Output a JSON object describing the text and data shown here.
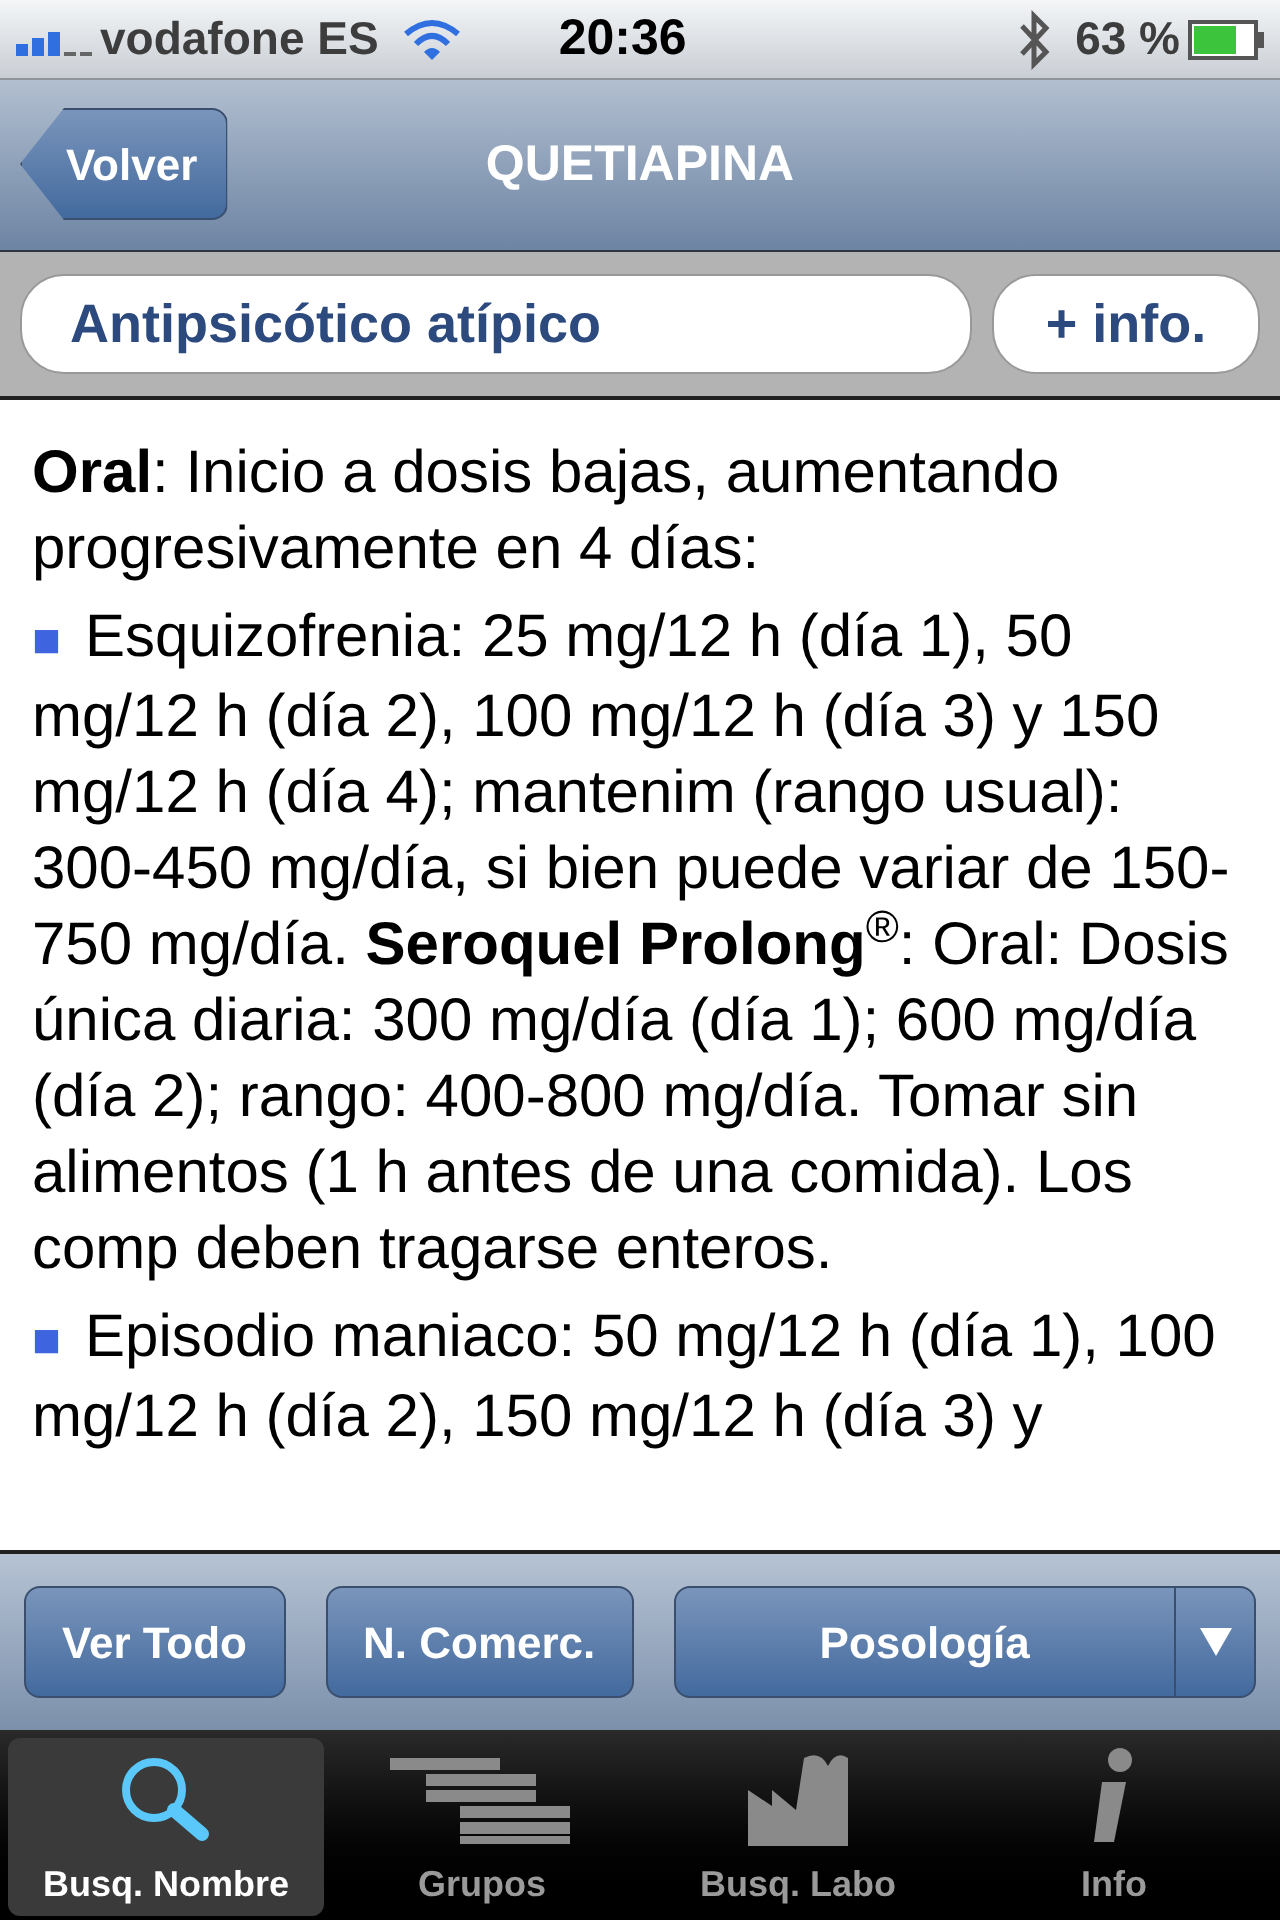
{
  "status_bar": {
    "carrier": "vodafone ES",
    "time": "20:36",
    "battery": "63 %"
  },
  "nav": {
    "back": "Volver",
    "title": "QUETIAPINA"
  },
  "header": {
    "group": "Antipsicótico atípico",
    "more": "+ info."
  },
  "content": [
    {
      "kind": "text",
      "text": "**Oral**: Inicio a dosis bajas, aumentando progresivamente en 4 días:"
    },
    {
      "kind": "bullet",
      "marker": "■",
      "text": "Esquizofrenia: 25 mg/12 h (día 1), 50 mg/12 h (día 2), 100 mg/12 h (día 3) y 150 mg/12 h (día 4); mantenim (rango usual): 300-450 mg/día, si bien puede variar de 150-750 mg/día. **Seroquel Prolong**$^{®}$: Oral: Dosis única diaria: 300 mg/día (día 1); 600 mg/día (día 2); rango: 400-800 mg/día. Tomar sin alimentos (1 h antes de una comida). Los comp deben tragarse enteros."
    },
    {
      "kind": "bullet",
      "marker": "■",
      "text": "Episodio maniaco: 50 mg/12 h (día 1), 100 mg/12 h (día 2), 150 mg/12 h (día 3) y"
    }
  ],
  "toolbar": {
    "buttons": [
      "Ver Todo",
      "N. Comerc."
    ],
    "dropdown": "Posología"
  },
  "tabs": [
    {
      "label": "Busq. Nombre",
      "selected": true,
      "kind": "search"
    },
    {
      "label": "Grupos",
      "selected": false,
      "kind": "groups"
    },
    {
      "label": "Busq. Labo",
      "selected": false,
      "kind": "factory"
    },
    {
      "label": "Info",
      "selected": false,
      "kind": "info"
    }
  ]
}
